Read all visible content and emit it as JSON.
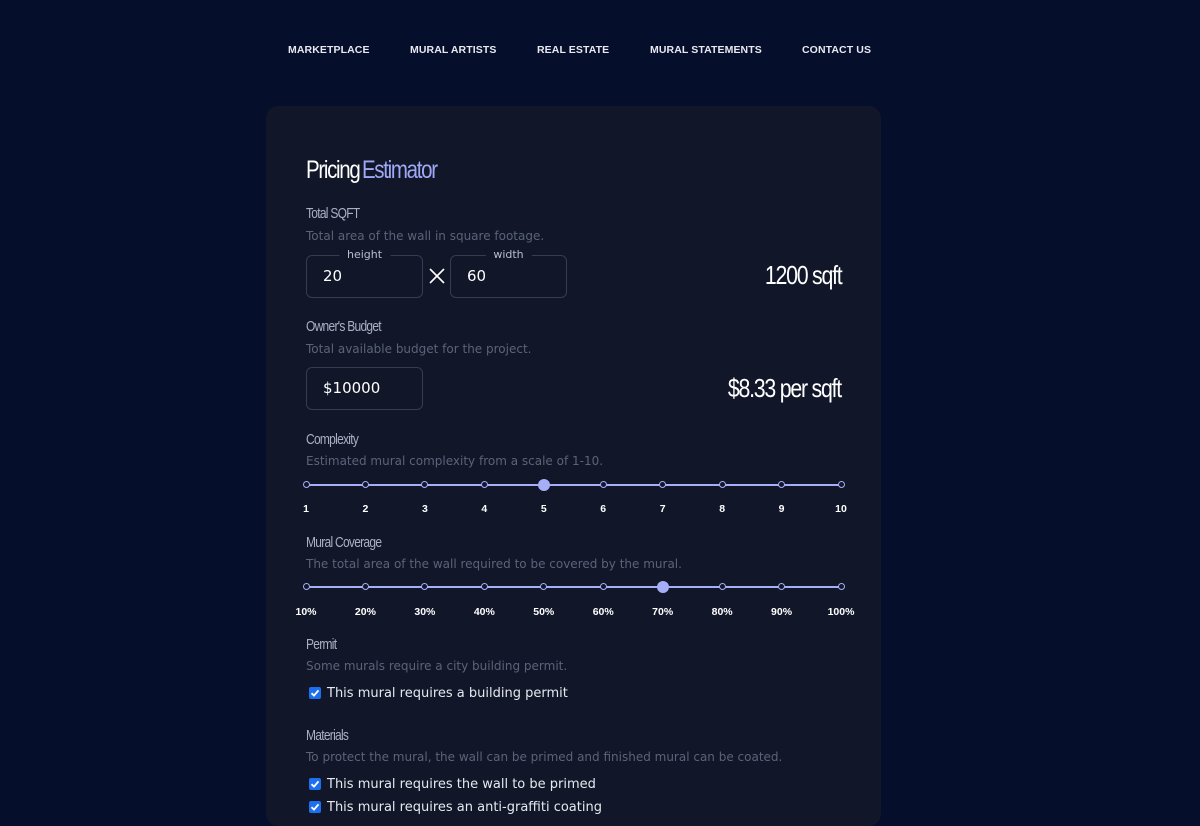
{
  "nav": {
    "items": [
      {
        "label": "MARKETPLACE"
      },
      {
        "label": "MURAL ARTISTS"
      },
      {
        "label": "REAL ESTATE"
      },
      {
        "label": "MURAL STATEMENTS"
      },
      {
        "label": "CONTACT US"
      }
    ]
  },
  "estimator": {
    "title_main": "Pricing",
    "title_accent": "Estimator",
    "colors": {
      "accent": "#9fa8f5",
      "background": "#050e2a",
      "card": "#111729",
      "checkbox": "#1e6ef0"
    },
    "total_sqft": {
      "label": "Total SQFT",
      "description": "Total area of the wall in square footage.",
      "height_legend": "height",
      "height_value": "20",
      "width_legend": "width",
      "width_value": "60",
      "times_icon": "multiply-icon",
      "result": "1200 sqft"
    },
    "budget": {
      "label": "Owner's Budget",
      "description": "Total available budget for the project.",
      "value": "$10000",
      "result": "$8.33 per sqft"
    },
    "complexity": {
      "label": "Complexity",
      "description": "Estimated mural complexity from a scale of 1-10.",
      "ticks": [
        "1",
        "2",
        "3",
        "4",
        "5",
        "6",
        "7",
        "8",
        "9",
        "10"
      ],
      "selected_index": 4,
      "selected_value": "5"
    },
    "coverage": {
      "label": "Mural Coverage",
      "description": "The total area of the wall required to be covered by the mural.",
      "ticks": [
        "10%",
        "20%",
        "30%",
        "40%",
        "50%",
        "60%",
        "70%",
        "80%",
        "90%",
        "100%"
      ],
      "selected_index": 6,
      "selected_value": "70%"
    },
    "permit": {
      "label": "Permit",
      "description": "Some murals require a city building permit.",
      "checkbox_label": "This mural requires a building permit",
      "checked": true
    },
    "materials": {
      "label": "Materials",
      "description": "To protect the mural, the wall can be primed and finished mural can be coated.",
      "options": [
        {
          "label": "This mural requires the wall to be primed",
          "checked": true
        },
        {
          "label": "This mural requires an anti-graffiti coating",
          "checked": true
        }
      ]
    }
  }
}
